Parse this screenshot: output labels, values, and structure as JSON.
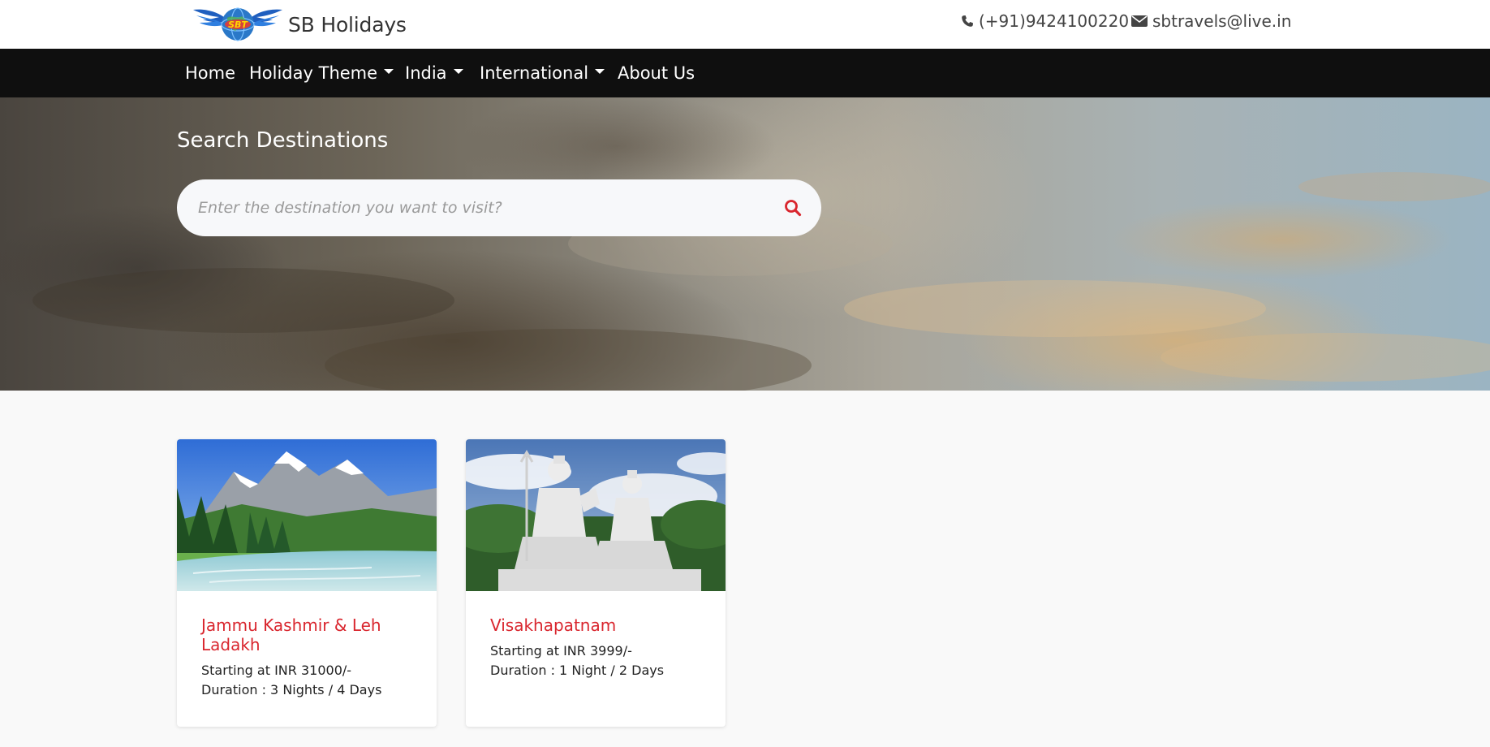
{
  "header": {
    "brand_name": "SB Holidays",
    "logo_text": "SBT",
    "phone": "(+91)9424100220",
    "email": "sbtravels@live.in",
    "phone_icon": "phone-icon",
    "email_icon": "envelope-icon"
  },
  "nav": {
    "items": [
      {
        "label": "Home",
        "dropdown": false
      },
      {
        "label": "Holiday Theme",
        "dropdown": true
      },
      {
        "label": "India",
        "dropdown": true
      },
      {
        "label": "International",
        "dropdown": true
      },
      {
        "label": "About Us",
        "dropdown": false
      }
    ]
  },
  "hero": {
    "title": "Search Destinations",
    "search_placeholder": "Enter the destination you want to visit?",
    "search_icon": "search-icon"
  },
  "packages": [
    {
      "title": "Jammu Kashmir & Leh Ladakh",
      "price": "Starting at INR 31000/-",
      "duration": "Duration : 3 Nights / 4 Days"
    },
    {
      "title": "Visakhapatnam",
      "price": "Starting at INR 3999/-",
      "duration": "Duration : 1 Night / 2 Days"
    }
  ],
  "colors": {
    "nav_bg": "#0f0f0f",
    "accent_red": "#d9262e",
    "page_bg": "#f9f9f9"
  }
}
